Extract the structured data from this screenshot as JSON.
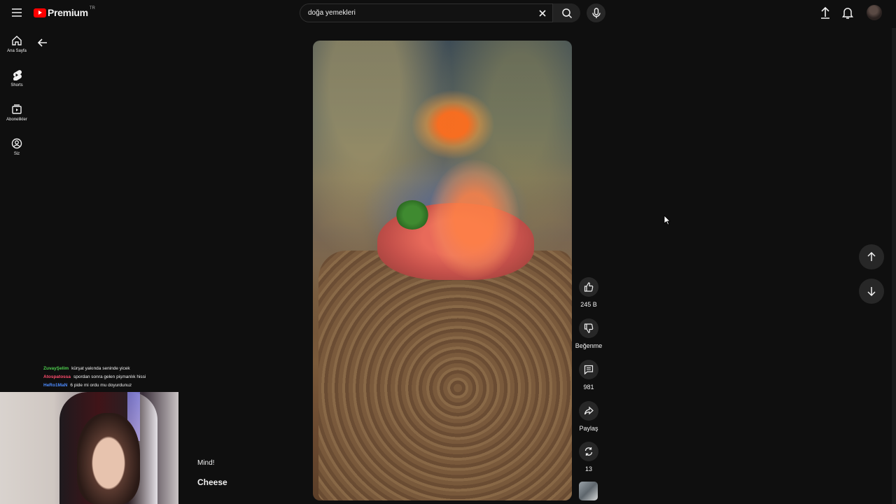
{
  "header": {
    "brand": "Premium",
    "region": "TR",
    "search_value": "doğa yemekleri"
  },
  "sidebar": {
    "items": [
      {
        "label": "Ana Sayfa",
        "icon": "home-icon"
      },
      {
        "label": "Shorts",
        "icon": "shorts-icon"
      },
      {
        "label": "Abonelikler",
        "icon": "subscriptions-icon"
      },
      {
        "label": "Siz",
        "icon": "account-icon"
      }
    ]
  },
  "actions": {
    "likes": "245 B",
    "dislike_label": "Beğenme",
    "comments": "981",
    "share_label": "Paylaş",
    "remix_count": "13"
  },
  "chat": [
    {
      "user": "ZuvayŞelim",
      "color": "#4fd14f",
      "message": "kürşat yakında seninde yicek"
    },
    {
      "user": "Atospatossa",
      "color": "#ff4d6d",
      "message": "spordan sonra gelen pişmanlık hissi"
    },
    {
      "user": "HeRo1MaN",
      "color": "#4d8cff",
      "message": "6 pide mi ordu mu doyurdunuz"
    }
  ],
  "overlay": {
    "line1": "Mind!",
    "line2": "Cheese"
  },
  "colors": {
    "background": "#0f0f0f",
    "brand_red": "#ff0000",
    "button_bg": "#272727"
  }
}
